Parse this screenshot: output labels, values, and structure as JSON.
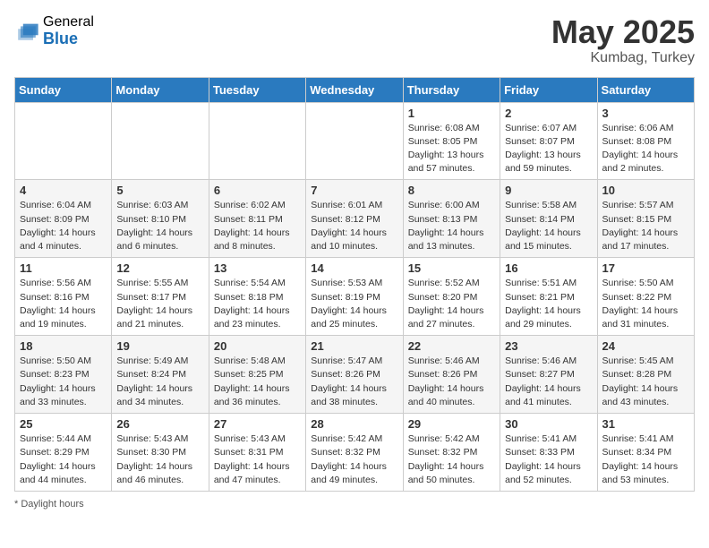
{
  "header": {
    "logo_general": "General",
    "logo_blue": "Blue",
    "month": "May 2025",
    "location": "Kumbag, Turkey"
  },
  "days_of_week": [
    "Sunday",
    "Monday",
    "Tuesday",
    "Wednesday",
    "Thursday",
    "Friday",
    "Saturday"
  ],
  "footer": {
    "note": "Daylight hours"
  },
  "weeks": [
    [
      {
        "day": "",
        "sunrise": "",
        "sunset": "",
        "daylight": ""
      },
      {
        "day": "",
        "sunrise": "",
        "sunset": "",
        "daylight": ""
      },
      {
        "day": "",
        "sunrise": "",
        "sunset": "",
        "daylight": ""
      },
      {
        "day": "",
        "sunrise": "",
        "sunset": "",
        "daylight": ""
      },
      {
        "day": "1",
        "sunrise": "Sunrise: 6:08 AM",
        "sunset": "Sunset: 8:05 PM",
        "daylight": "Daylight: 13 hours and 57 minutes."
      },
      {
        "day": "2",
        "sunrise": "Sunrise: 6:07 AM",
        "sunset": "Sunset: 8:07 PM",
        "daylight": "Daylight: 13 hours and 59 minutes."
      },
      {
        "day": "3",
        "sunrise": "Sunrise: 6:06 AM",
        "sunset": "Sunset: 8:08 PM",
        "daylight": "Daylight: 14 hours and 2 minutes."
      }
    ],
    [
      {
        "day": "4",
        "sunrise": "Sunrise: 6:04 AM",
        "sunset": "Sunset: 8:09 PM",
        "daylight": "Daylight: 14 hours and 4 minutes."
      },
      {
        "day": "5",
        "sunrise": "Sunrise: 6:03 AM",
        "sunset": "Sunset: 8:10 PM",
        "daylight": "Daylight: 14 hours and 6 minutes."
      },
      {
        "day": "6",
        "sunrise": "Sunrise: 6:02 AM",
        "sunset": "Sunset: 8:11 PM",
        "daylight": "Daylight: 14 hours and 8 minutes."
      },
      {
        "day": "7",
        "sunrise": "Sunrise: 6:01 AM",
        "sunset": "Sunset: 8:12 PM",
        "daylight": "Daylight: 14 hours and 10 minutes."
      },
      {
        "day": "8",
        "sunrise": "Sunrise: 6:00 AM",
        "sunset": "Sunset: 8:13 PM",
        "daylight": "Daylight: 14 hours and 13 minutes."
      },
      {
        "day": "9",
        "sunrise": "Sunrise: 5:58 AM",
        "sunset": "Sunset: 8:14 PM",
        "daylight": "Daylight: 14 hours and 15 minutes."
      },
      {
        "day": "10",
        "sunrise": "Sunrise: 5:57 AM",
        "sunset": "Sunset: 8:15 PM",
        "daylight": "Daylight: 14 hours and 17 minutes."
      }
    ],
    [
      {
        "day": "11",
        "sunrise": "Sunrise: 5:56 AM",
        "sunset": "Sunset: 8:16 PM",
        "daylight": "Daylight: 14 hours and 19 minutes."
      },
      {
        "day": "12",
        "sunrise": "Sunrise: 5:55 AM",
        "sunset": "Sunset: 8:17 PM",
        "daylight": "Daylight: 14 hours and 21 minutes."
      },
      {
        "day": "13",
        "sunrise": "Sunrise: 5:54 AM",
        "sunset": "Sunset: 8:18 PM",
        "daylight": "Daylight: 14 hours and 23 minutes."
      },
      {
        "day": "14",
        "sunrise": "Sunrise: 5:53 AM",
        "sunset": "Sunset: 8:19 PM",
        "daylight": "Daylight: 14 hours and 25 minutes."
      },
      {
        "day": "15",
        "sunrise": "Sunrise: 5:52 AM",
        "sunset": "Sunset: 8:20 PM",
        "daylight": "Daylight: 14 hours and 27 minutes."
      },
      {
        "day": "16",
        "sunrise": "Sunrise: 5:51 AM",
        "sunset": "Sunset: 8:21 PM",
        "daylight": "Daylight: 14 hours and 29 minutes."
      },
      {
        "day": "17",
        "sunrise": "Sunrise: 5:50 AM",
        "sunset": "Sunset: 8:22 PM",
        "daylight": "Daylight: 14 hours and 31 minutes."
      }
    ],
    [
      {
        "day": "18",
        "sunrise": "Sunrise: 5:50 AM",
        "sunset": "Sunset: 8:23 PM",
        "daylight": "Daylight: 14 hours and 33 minutes."
      },
      {
        "day": "19",
        "sunrise": "Sunrise: 5:49 AM",
        "sunset": "Sunset: 8:24 PM",
        "daylight": "Daylight: 14 hours and 34 minutes."
      },
      {
        "day": "20",
        "sunrise": "Sunrise: 5:48 AM",
        "sunset": "Sunset: 8:25 PM",
        "daylight": "Daylight: 14 hours and 36 minutes."
      },
      {
        "day": "21",
        "sunrise": "Sunrise: 5:47 AM",
        "sunset": "Sunset: 8:26 PM",
        "daylight": "Daylight: 14 hours and 38 minutes."
      },
      {
        "day": "22",
        "sunrise": "Sunrise: 5:46 AM",
        "sunset": "Sunset: 8:26 PM",
        "daylight": "Daylight: 14 hours and 40 minutes."
      },
      {
        "day": "23",
        "sunrise": "Sunrise: 5:46 AM",
        "sunset": "Sunset: 8:27 PM",
        "daylight": "Daylight: 14 hours and 41 minutes."
      },
      {
        "day": "24",
        "sunrise": "Sunrise: 5:45 AM",
        "sunset": "Sunset: 8:28 PM",
        "daylight": "Daylight: 14 hours and 43 minutes."
      }
    ],
    [
      {
        "day": "25",
        "sunrise": "Sunrise: 5:44 AM",
        "sunset": "Sunset: 8:29 PM",
        "daylight": "Daylight: 14 hours and 44 minutes."
      },
      {
        "day": "26",
        "sunrise": "Sunrise: 5:43 AM",
        "sunset": "Sunset: 8:30 PM",
        "daylight": "Daylight: 14 hours and 46 minutes."
      },
      {
        "day": "27",
        "sunrise": "Sunrise: 5:43 AM",
        "sunset": "Sunset: 8:31 PM",
        "daylight": "Daylight: 14 hours and 47 minutes."
      },
      {
        "day": "28",
        "sunrise": "Sunrise: 5:42 AM",
        "sunset": "Sunset: 8:32 PM",
        "daylight": "Daylight: 14 hours and 49 minutes."
      },
      {
        "day": "29",
        "sunrise": "Sunrise: 5:42 AM",
        "sunset": "Sunset: 8:32 PM",
        "daylight": "Daylight: 14 hours and 50 minutes."
      },
      {
        "day": "30",
        "sunrise": "Sunrise: 5:41 AM",
        "sunset": "Sunset: 8:33 PM",
        "daylight": "Daylight: 14 hours and 52 minutes."
      },
      {
        "day": "31",
        "sunrise": "Sunrise: 5:41 AM",
        "sunset": "Sunset: 8:34 PM",
        "daylight": "Daylight: 14 hours and 53 minutes."
      }
    ]
  ]
}
